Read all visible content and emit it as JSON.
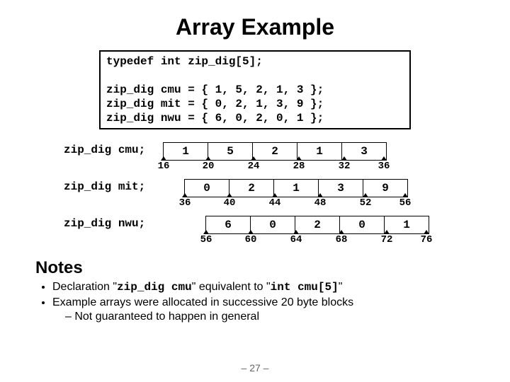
{
  "title": "Array Example",
  "code": {
    "typedef": "typedef int zip_dig[5];",
    "decl1": "zip_dig cmu = { 1, 5, 2, 1, 3 };",
    "decl2": "zip_dig mit = { 0, 2, 1, 3, 9 };",
    "decl3": "zip_dig nwu = { 6, 0, 2, 0, 1 };"
  },
  "arrays": {
    "cmu": {
      "label": "zip_dig cmu;",
      "cells": [
        "1",
        "5",
        "2",
        "1",
        "3"
      ],
      "addrs": [
        "16",
        "20",
        "24",
        "28",
        "32",
        "36"
      ]
    },
    "mit": {
      "label": "zip_dig mit;",
      "cells": [
        "0",
        "2",
        "1",
        "3",
        "9"
      ],
      "addrs": [
        "36",
        "40",
        "44",
        "48",
        "52",
        "56"
      ]
    },
    "nwu": {
      "label": "zip_dig nwu;",
      "cells": [
        "6",
        "0",
        "2",
        "0",
        "1"
      ],
      "addrs": [
        "56",
        "60",
        "64",
        "68",
        "72",
        "76"
      ]
    }
  },
  "notes_heading": "Notes",
  "notes": {
    "b1_a": "Declaration \"",
    "b1_code1": "zip_dig cmu",
    "b1_b": "\" equivalent to \"",
    "b1_code2": "int cmu[5]",
    "b1_c": "\"",
    "b2": "Example arrays were allocated in successive 20 byte blocks",
    "b2_sub": "Not guaranteed to happen in general"
  },
  "page": "– 27 –",
  "chart_data": {
    "type": "table",
    "title": "Array memory layout (zip_dig = int[5])",
    "arrays": [
      {
        "name": "cmu",
        "base_addr": 16,
        "stride_bytes": 4,
        "values": [
          1,
          5,
          2,
          1,
          3
        ],
        "addresses": [
          16,
          20,
          24,
          28,
          32
        ],
        "end": 36
      },
      {
        "name": "mit",
        "base_addr": 36,
        "stride_bytes": 4,
        "values": [
          0,
          2,
          1,
          3,
          9
        ],
        "addresses": [
          36,
          40,
          44,
          48,
          52
        ],
        "end": 56
      },
      {
        "name": "nwu",
        "base_addr": 56,
        "stride_bytes": 4,
        "values": [
          6,
          0,
          2,
          0,
          1
        ],
        "addresses": [
          56,
          60,
          64,
          68,
          72
        ],
        "end": 76
      }
    ]
  }
}
